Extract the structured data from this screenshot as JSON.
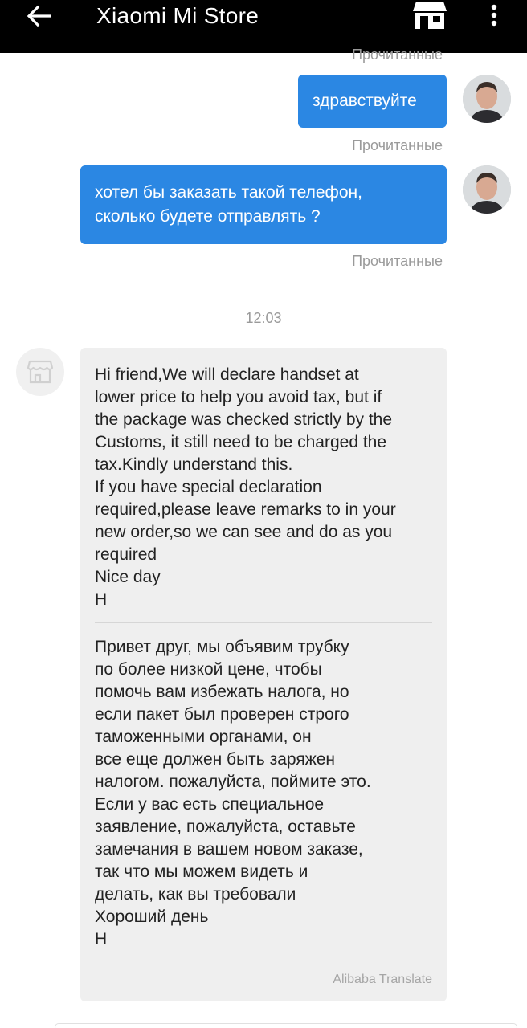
{
  "header": {
    "title": "Xiaomi Mi Store",
    "back_icon": "arrow-left-icon",
    "store_icon": "store-icon",
    "more_icon": "more-vert-icon"
  },
  "messages": [
    {
      "text": "здравствуйте",
      "status": "Прочитанные"
    },
    {
      "text": "хотел бы заказать такой телефон,\nсколько будете отправлять ?",
      "status": "Прочитанные"
    }
  ],
  "top_status": "Прочитанные",
  "timestamp": "12:03",
  "reply": {
    "original": "Hi friend,We will declare handset at\nlower price to help you avoid tax, but if\nthe package was checked strictly by the\nCustoms, it still need to be charged the\ntax.Kindly understand this.\nIf you have special declaration\nrequired,please leave remarks to in your\nnew order,so we can see and do as you\nrequired\nNice day\nH",
    "translation": "Привет друг, мы объявим трубку\nпо более низкой цене, чтобы\nпомочь вам избежать налога, но\nесли пакет был проверен строго\nтаможенными органами, он\nвсе еще должен быть заряжен\nналогом. пожалуйста, поймите это.\nЕсли у вас есть специальное\nзаявление, пожалуйста, оставьте\nзамечания в вашем новом заказе,\nтак что мы можем видеть и\nделать, как вы требовали\nХороший день\nH",
    "translator": "Alibaba Translate"
  },
  "colors": {
    "header_bg": "#000000",
    "outgoing_bubble": "#2b87e3",
    "incoming_bubble": "#efefef",
    "status_text": "#9a9a9a"
  }
}
